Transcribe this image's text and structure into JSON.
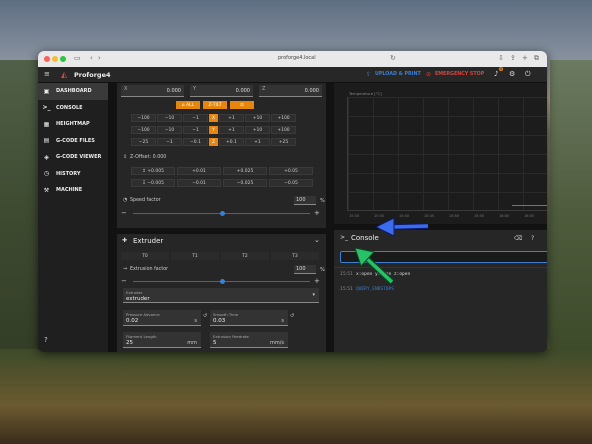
{
  "browser": {
    "url": "proforge4.local"
  },
  "app": {
    "title": "Proforge4",
    "upload_label": "UPLOAD & PRINT",
    "estop_label": "EMERGENCY STOP",
    "notif_count": "0"
  },
  "sidebar": {
    "items": [
      {
        "label": "DASHBOARD",
        "icon": "dashboard-icon"
      },
      {
        "label": "CONSOLE",
        "icon": "console-icon"
      },
      {
        "label": "HEIGHTMAP",
        "icon": "heightmap-icon"
      },
      {
        "label": "G-CODE FILES",
        "icon": "files-icon"
      },
      {
        "label": "G-CODE VIEWER",
        "icon": "viewer-icon"
      },
      {
        "label": "HISTORY",
        "icon": "history-icon"
      },
      {
        "label": "MACHINE",
        "icon": "machine-icon"
      }
    ]
  },
  "position": {
    "x_label": "X",
    "x_val": "0.000",
    "y_label": "Y",
    "y_val": "0.000",
    "z_label": "Z",
    "z_val": "0.000"
  },
  "home": {
    "all": "ALL",
    "ztilt": "Z-TILT",
    "qgl": "QGL"
  },
  "moves": {
    "xy_neg": [
      "−100",
      "−10",
      "−1"
    ],
    "xy_pos": [
      "+1",
      "+10",
      "+100"
    ],
    "x": "X",
    "y": "Y",
    "z": "Z",
    "z_neg": [
      "−25",
      "−1",
      "−0.1"
    ],
    "z_pos": [
      "+0.1",
      "+1",
      "+25"
    ]
  },
  "zoffset": {
    "label": "Z-Offset: 0.000",
    "up": [
      "+0.005",
      "+0.01",
      "+0.025",
      "+0.05"
    ],
    "down": [
      "−0.005",
      "−0.01",
      "−0.025",
      "−0.05"
    ]
  },
  "speed": {
    "label": "Speed factor",
    "value": "100",
    "unit": "%",
    "fraction": 0.5
  },
  "extruder": {
    "title": "Extruder",
    "tools": [
      "T0",
      "T1",
      "T2",
      "T3"
    ],
    "factor_label": "Extrusion factor",
    "factor_value": "100",
    "factor_unit": "%",
    "factor_fraction": 0.5,
    "select_label": "Extruder",
    "select_value": "extruder",
    "pa_label": "Pressure Advance",
    "pa_value": "0.02",
    "pa_unit": "s",
    "st_label": "Smooth Time",
    "st_value": "0.03",
    "st_unit": "s",
    "fl_label": "Filament Length",
    "fl_value": "25",
    "fl_unit": "mm",
    "ef_label": "Extrusion Feedrate",
    "ef_value": "5",
    "ef_unit": "mm/s"
  },
  "temp_chart": {
    "legend": "Temperature [°C]",
    "ticks": [
      "15:30",
      "15:35",
      "15:40",
      "15:45",
      "15:50",
      "15:55",
      "16:00",
      "16:05",
      "16:10",
      "16:15"
    ]
  },
  "console": {
    "title": "Console",
    "entries": [
      {
        "time": "15:51",
        "text": "x:open y:open z:open"
      },
      {
        "time": "15:51",
        "text": "QUERY_ENDSTOPS"
      }
    ]
  },
  "colors": {
    "accent": "#e8860b",
    "link": "#3b7fd1",
    "estop": "#d9433a"
  }
}
